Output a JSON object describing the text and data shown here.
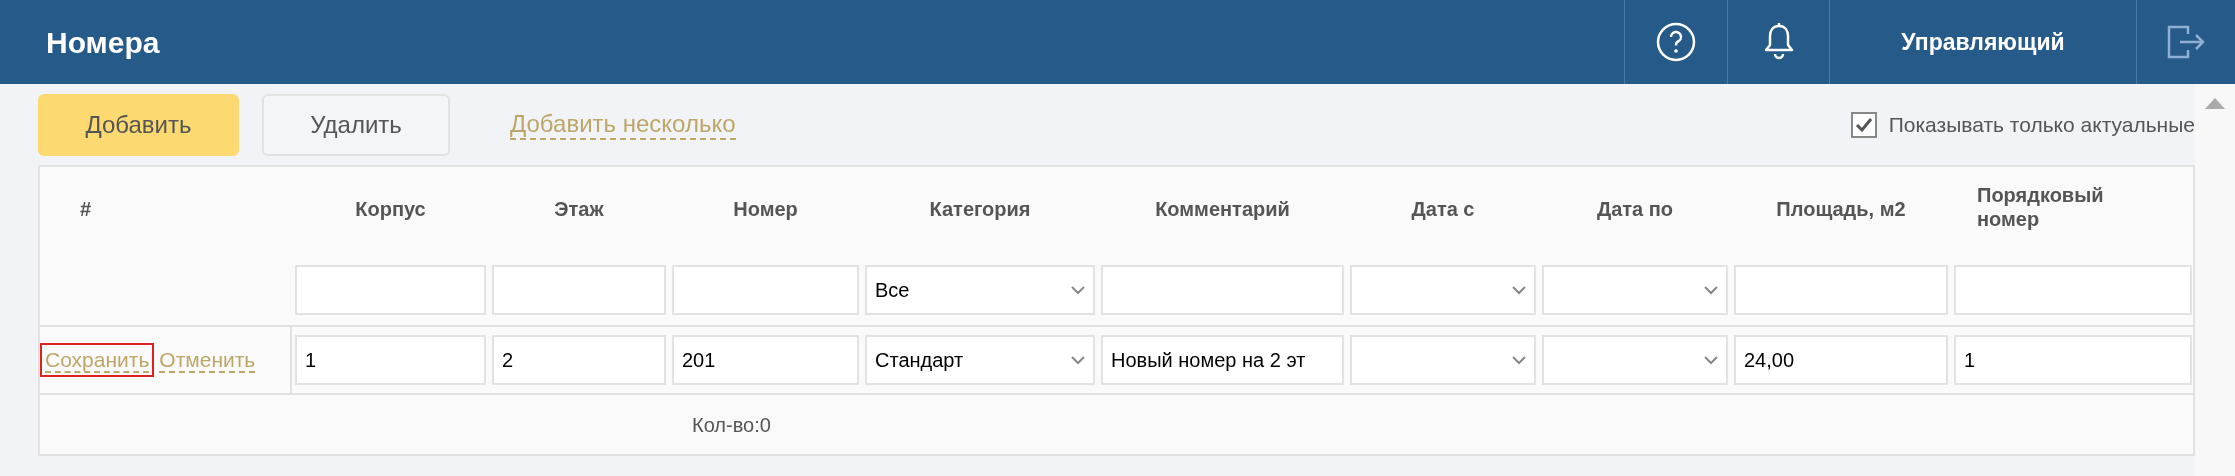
{
  "header": {
    "title": "Номера",
    "user": "Управляющий"
  },
  "toolbar": {
    "buttons": [
      {
        "label": "Добавить",
        "kind": "primary"
      },
      {
        "label": "Удалить",
        "kind": "secondary"
      }
    ],
    "link": "Добавить несколько",
    "filter_checkbox": {
      "label": "Показывать только актуальные",
      "checked": true
    }
  },
  "table": {
    "columns": [
      {
        "label": "#"
      },
      {
        "label": "Корпус"
      },
      {
        "label": "Этаж"
      },
      {
        "label": "Номер"
      },
      {
        "label": "Категория"
      },
      {
        "label": "Комментарий"
      },
      {
        "label": "Дата с"
      },
      {
        "label": "Дата по"
      },
      {
        "label": "Площадь, м2"
      },
      {
        "label": "Порядковый номер"
      }
    ],
    "filters": [
      {
        "kind": "text"
      },
      {
        "kind": "text"
      },
      {
        "kind": "text"
      },
      {
        "kind": "select",
        "value": "Все"
      },
      {
        "kind": "text"
      },
      {
        "kind": "select"
      },
      {
        "kind": "select"
      },
      {
        "kind": "text"
      },
      {
        "kind": "text"
      }
    ],
    "edit_row": {
      "actions": [
        {
          "label": "Сохранить",
          "highlighted": true
        },
        {
          "label": "Отменить",
          "highlighted": false
        }
      ],
      "cells": [
        {
          "kind": "text",
          "value": "1"
        },
        {
          "kind": "text",
          "value": "2"
        },
        {
          "kind": "text",
          "value": "201"
        },
        {
          "kind": "select",
          "value": "Стандарт"
        },
        {
          "kind": "text",
          "value": "Новый номер на 2 эт"
        },
        {
          "kind": "select"
        },
        {
          "kind": "select"
        },
        {
          "kind": "text",
          "value": "24,00"
        },
        {
          "kind": "text",
          "value": "1"
        }
      ]
    },
    "footer": "Кол-во:0"
  }
}
